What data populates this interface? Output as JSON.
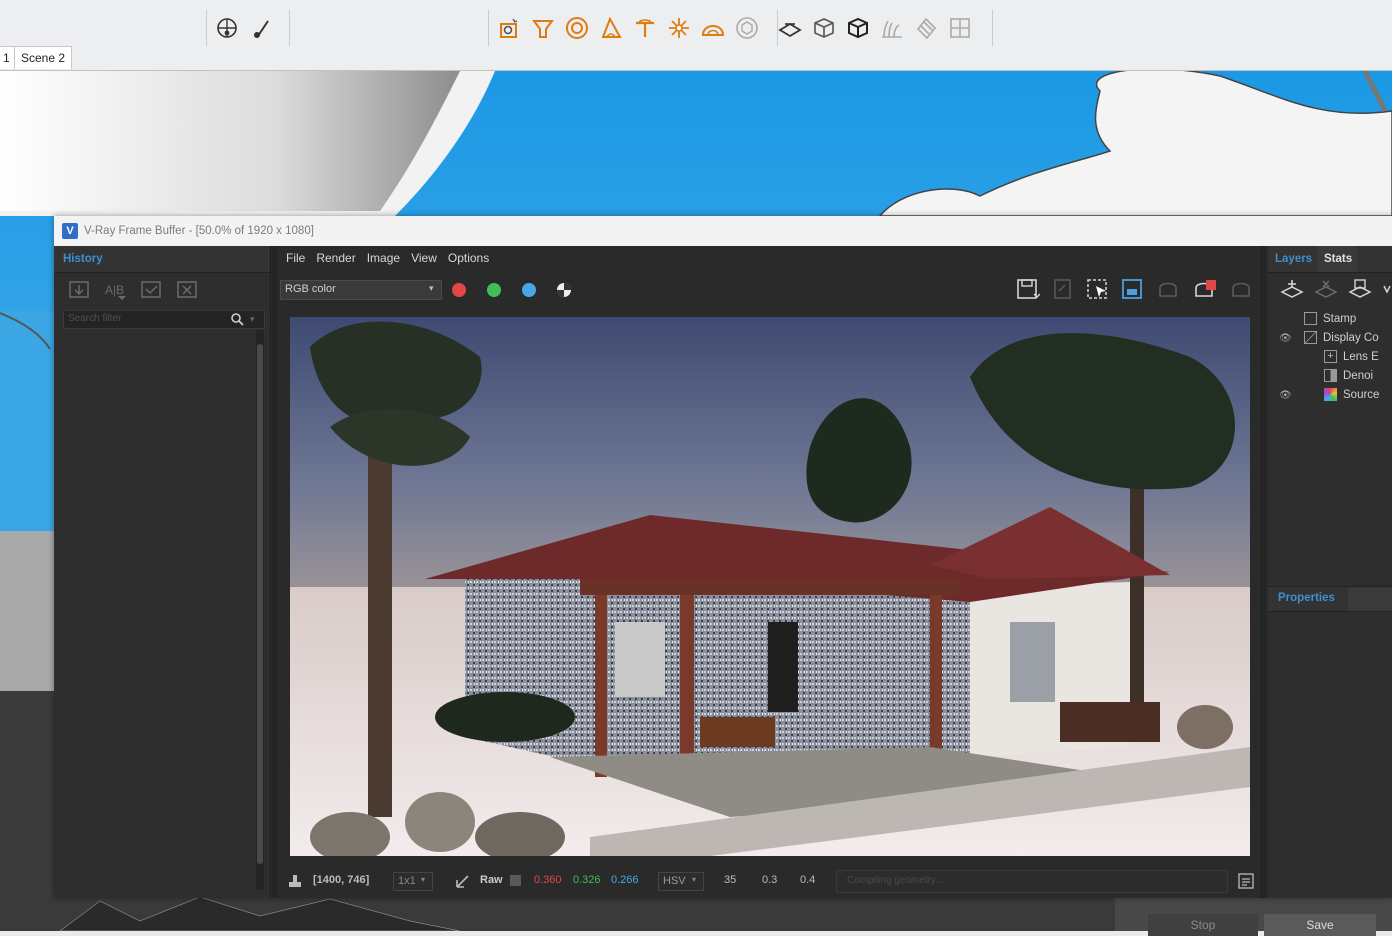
{
  "scene_tabs": [
    {
      "label": "1"
    },
    {
      "label": "Scene 2"
    }
  ],
  "vfb": {
    "title": "V-Ray Frame Buffer - [50.0% of 1920 x 1080]",
    "history": {
      "header": "History",
      "search_placeholder": "Search filter"
    },
    "menu": [
      "File",
      "Render",
      "Image",
      "View",
      "Options"
    ],
    "channel_select": "RGB color",
    "layers_tab": "Layers",
    "stats_tab": "Stats",
    "layers": [
      {
        "label": "Stamp",
        "visible": false
      },
      {
        "label": "Display Co",
        "visible": true
      },
      {
        "label": "Lens E",
        "visible": false
      },
      {
        "label": "Denoi",
        "visible": false
      },
      {
        "label": "Source",
        "visible": true
      }
    ],
    "properties_header": "Properties",
    "status": {
      "coords": "[1400, 746]",
      "zoom": "1x1",
      "mode": "Raw",
      "r": "0.360",
      "g": "0.326",
      "b": "0.266",
      "color_space": "HSV",
      "h": "35",
      "s": "0.3",
      "v": "0.4",
      "progress_text": "Compiling geometry..."
    },
    "colors": {
      "red": "#e04848",
      "green": "#3fbf55",
      "blue": "#47a8e8",
      "accent": "#3d8fd1"
    }
  },
  "bottom_buttons": {
    "stop": "Stop",
    "save": "Save"
  }
}
